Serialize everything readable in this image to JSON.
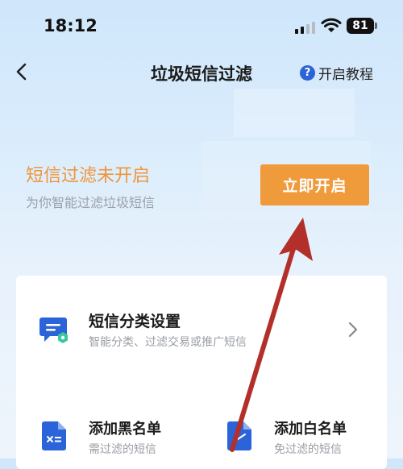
{
  "status_bar": {
    "time": "18:12",
    "battery": "81"
  },
  "nav": {
    "title": "垃圾短信过滤",
    "tutorial_label": "开启教程",
    "help_glyph": "?"
  },
  "filter": {
    "status_text": "短信过滤未开启",
    "subtitle": "为你智能过滤垃圾短信",
    "enable_button": "立即开启"
  },
  "settings": {
    "category": {
      "title": "短信分类设置",
      "subtitle": "智能分类、过滤交易或推广短信"
    },
    "blacklist": {
      "title": "添加黑名单",
      "subtitle": "需过滤的短信"
    },
    "whitelist": {
      "title": "添加白名单",
      "subtitle": "免过滤的短信"
    }
  },
  "colors": {
    "accent_orange": "#ef9a3b",
    "status_orange": "#f0953a",
    "brand_blue": "#2b63d8",
    "annotation_arrow": "#b3302a"
  },
  "icons": [
    "back-chevron-icon",
    "help-icon",
    "message-icon",
    "chevron-right-icon",
    "document-icon",
    "signal-icon",
    "wifi-icon",
    "battery-icon"
  ]
}
